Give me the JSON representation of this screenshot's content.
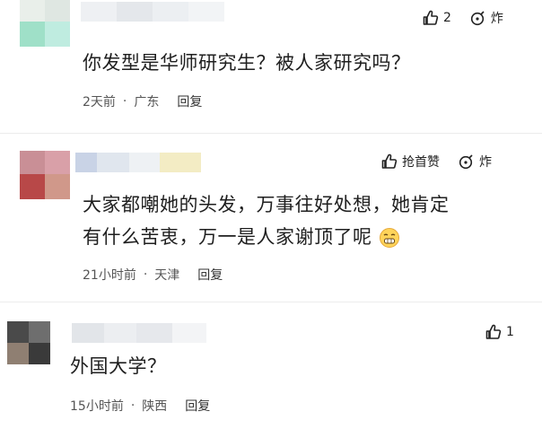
{
  "comments": [
    {
      "text": "你发型是华师研究生？被人家研究吗？",
      "time": "2天前",
      "location": "广东",
      "reply_label": "回复",
      "like_count": "2",
      "dislike_label": "炸"
    },
    {
      "text_line1": "大家都嘲她的头发，万事往好处想，她肯定",
      "text_line2": "有什么苦衷，万一是人家谢顶了呢",
      "time": "21小时前",
      "location": "天津",
      "reply_label": "回复",
      "like_label": "抢首赞",
      "dislike_label": "炸"
    },
    {
      "text": "外国大学？",
      "time": "15小时前",
      "location": "陕西",
      "reply_label": "回复",
      "like_count": "1"
    }
  ],
  "meta_separator": "·",
  "colors": {
    "text": "#1f1f1f",
    "meta": "#555555",
    "background": "#ffffff"
  }
}
